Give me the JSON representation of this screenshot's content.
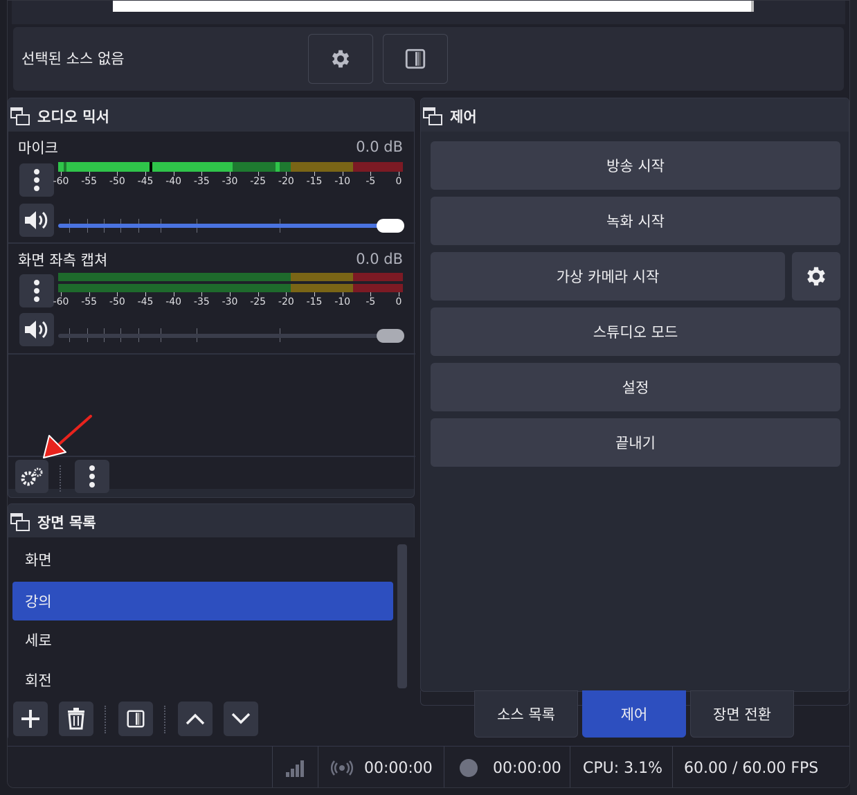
{
  "source_bar": {
    "label": "선택된 소스 없음"
  },
  "audio_mixer": {
    "title": "오디오 믹서",
    "channels": [
      {
        "name": "마이크",
        "db": "0.0 dB"
      },
      {
        "name": "화면 좌측 캡쳐",
        "db": "0.0 dB"
      }
    ],
    "tick_labels": [
      "-60",
      "-55",
      "-50",
      "-45",
      "-40",
      "-35",
      "-30",
      "-25",
      "-20",
      "-15",
      "-10",
      "-5",
      "0"
    ]
  },
  "controls": {
    "title": "제어",
    "buttons": {
      "stream": "방송 시작",
      "record": "녹화 시작",
      "virtual_cam": "가상 카메라 시작",
      "studio": "스튜디오 모드",
      "settings": "설정",
      "exit": "끝내기"
    }
  },
  "scenes": {
    "title": "장면 목록",
    "items": [
      "화면",
      "강의",
      "세로",
      "회전"
    ],
    "selected": "강의"
  },
  "tabs": {
    "sources": "소스 목록",
    "controls": "제어",
    "transitions": "장면 전환"
  },
  "status": {
    "stream_time": "00:00:00",
    "record_time": "00:00:00",
    "cpu": "CPU: 3.1%",
    "fps": "60.00 / 60.00 FPS"
  },
  "colors": {
    "accent": "#2d4fbf",
    "meter_green": "#2fc44a",
    "meter_yellow": "#7a6516",
    "meter_red": "#7c1a24",
    "slider_blue": "#4a73e0"
  }
}
